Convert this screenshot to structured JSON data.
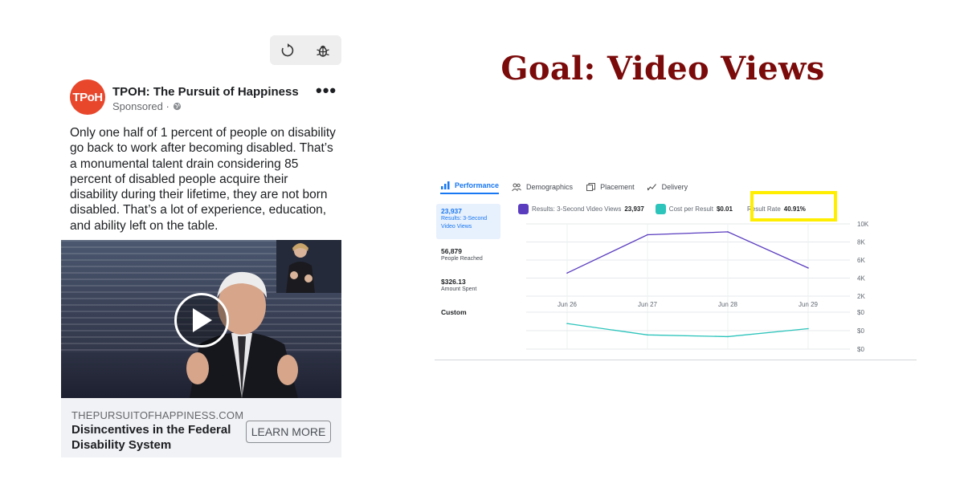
{
  "colors": {
    "fb_blue": "#1877f2",
    "goal_red": "#7b0a0a",
    "series_purple": "#5a3dbf",
    "series_teal": "#2cc4bb",
    "highlight_yellow": "#ffee00"
  },
  "toolbar": {
    "refresh_icon": "refresh-icon",
    "debug_icon": "bug-icon"
  },
  "post": {
    "avatar_text": "TPoH",
    "page_name": "TPOH: The Pursuit of Happiness",
    "sponsored": "Sponsored ·",
    "more": "•••",
    "body": "Only one half of 1 percent of people on disability go back to work after becoming disabled. That’s a monumental talent drain considering 85 percent of disabled people acquire their disability during their lifetime, they are not born disabled. That’s a lot of experience, education, and ability left on the table.",
    "link_domain": "THEPURSUITOFHAPPINESS.COM",
    "link_title": "Disincentives in the Federal Disability System",
    "cta": "LEARN MORE"
  },
  "headline": "Goal: Video Views",
  "analytics": {
    "tabs": [
      {
        "label": "Performance",
        "icon": "bar-chart-icon"
      },
      {
        "label": "Demographics",
        "icon": "people-icon"
      },
      {
        "label": "Placement",
        "icon": "copy-icon"
      },
      {
        "label": "Delivery",
        "icon": "trend-icon"
      }
    ],
    "metrics": [
      {
        "value": "23,937",
        "label": "Results: 3-Second Video Views"
      },
      {
        "value": "56,879",
        "label": "People Reached"
      },
      {
        "value": "$326.13",
        "label": "Amount Spent"
      },
      {
        "value": "Custom",
        "label": ""
      }
    ],
    "legend": [
      {
        "label": "Results: 3-Second Video Views",
        "value": "23,937"
      },
      {
        "label": "Cost per Result",
        "value": "$0.01"
      },
      {
        "label": "Result Rate",
        "value": "40.91%"
      }
    ]
  },
  "chart_data": [
    {
      "type": "line",
      "x": [
        "Jun 26",
        "Jun 27",
        "Jun 28",
        "Jun 29"
      ],
      "series": [
        {
          "name": "Results: 3-Second Video Views",
          "values": [
            3200,
            8500,
            8900,
            3900
          ]
        }
      ],
      "yticks": [
        "10K",
        "8K",
        "6K",
        "4K",
        "2K"
      ],
      "ylim": [
        0,
        10000
      ]
    },
    {
      "type": "line",
      "x": [
        "Jun 26",
        "Jun 27",
        "Jun 28",
        "Jun 29"
      ],
      "series": [
        {
          "name": "Cost per Result",
          "values": [
            0.0155,
            0.0135,
            0.0132,
            0.0146
          ]
        }
      ],
      "yticks": [
        "$0",
        "$0",
        "$0"
      ]
    }
  ]
}
